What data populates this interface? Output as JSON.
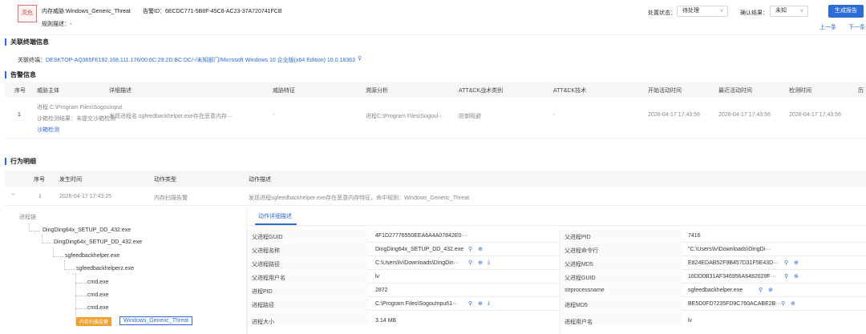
{
  "header": {
    "severity_tag": "高危",
    "threat_label": "内存威胁:Windows_Generic_Threat",
    "alert_id_label": "告警ID：6ECDC771-5B8F-45C8-AC23-37A720741FCB",
    "rule_desc_label": "规则描述：-",
    "status_label": "处置状态：",
    "status_value": "待处理",
    "confirm_label": "确认结果：",
    "confirm_value": "未知",
    "generate_report": "生成报告",
    "prev": "上一条",
    "next": "下一条"
  },
  "related_terminal": {
    "title": "关联终端信息",
    "label": "关联终端：",
    "value": "DESKTOP-AQ365Ff/192.168.111.176/00:0C:29:2D:BC:DC/-/未知部门/Microsoft Windows 10 企业版(x64 Edition) 10.0.18363"
  },
  "alert_info": {
    "title": "告警信息",
    "columns": [
      "序号",
      "威胁主体",
      "详细描述",
      "威胁特征",
      "溯源分析",
      "ATT&CK战术类别",
      "ATT&CK技术",
      "开始活动时间",
      "最近活动时间",
      "检测时间",
      "历"
    ],
    "row": {
      "index": "1",
      "subject_line1": "进程 C:\\Program Files\\SogouInput",
      "subject_line2": "沙箱检测结果：未提交沙箱检测",
      "subject_line3": "沙箱检测",
      "desc": "发现进程名:sgfeedbackhelper.exe存在恶意内存···",
      "feature": "-",
      "trace": "进程C:\\Program Files\\Sogoul···",
      "tactic": "防御规避",
      "technique": "-",
      "start": "2026-04-17 17:43:56",
      "recent": "2026-04-17 17:43:56",
      "detect": "2026-04-17 17:43:56"
    }
  },
  "behavior": {
    "title": "行为明细",
    "columns": [
      "序号",
      "发生时间",
      "动作类型",
      "动作描述"
    ],
    "row": {
      "collapse": "−",
      "index": "1",
      "time": "2026-04-17 17:43:25",
      "type": "内存扫描告警",
      "desc": "发现进程sgfeedbackhelper.exe存在恶意内存特征，命中规则：Windows_Generic_Threat"
    },
    "tree_title": "进程链",
    "tree": [
      "DingDing64x_SETUP_DD_432.exe",
      "DingDing64x_SETUP_DD_432.exe",
      "sgfeedbackhelper.exe",
      "sgfeedbackhelperz.exe",
      "cmd.exe",
      "cmd.exe",
      "cmd.exe"
    ],
    "tree_badge1": "内存扫描告警",
    "tree_badge2": "Windows_Generic_Threat",
    "detail_tab": "动作详细描述",
    "detail_rows": [
      {
        "k1": "父进程GUID",
        "v1": "4F1D27776550EEA6A4A07842E0···",
        "k2": "父进程PID",
        "v2": "7416"
      },
      {
        "k1": "父进程名称",
        "v1": "DingDing64x_SETUP_DD_432.exe",
        "k2": "父进程命令行",
        "v2": "\"C:\\Users\\lv\\Downloads\\DingDi···"
      },
      {
        "k1": "父进程路径",
        "v1": "C:\\Users\\lv\\Downloads\\DingDin···",
        "k2": "父进程MD5",
        "v2": "E824EDAB52F9B457D31F5E43D···"
      },
      {
        "k1": "父进程用户名",
        "v1": "lv",
        "k2": "父进程GUID",
        "v2": "16DD0B31AF346956A6482029F···"
      },
      {
        "k1": "进程PID",
        "v1": "2872",
        "k2": "strprocessname",
        "v2": "sgfeedbackhelper.exe"
      },
      {
        "k1": "进程路径",
        "v1": "C:\\Program Files\\SogouInput\\1···",
        "k2": "进程MD5",
        "v2": "BE5D0FD7235FD9C760ACABE2B···"
      },
      {
        "k1": "进程大小",
        "v1": "3.14 MB",
        "k2": "进程用户名",
        "v2": "lv"
      }
    ]
  }
}
